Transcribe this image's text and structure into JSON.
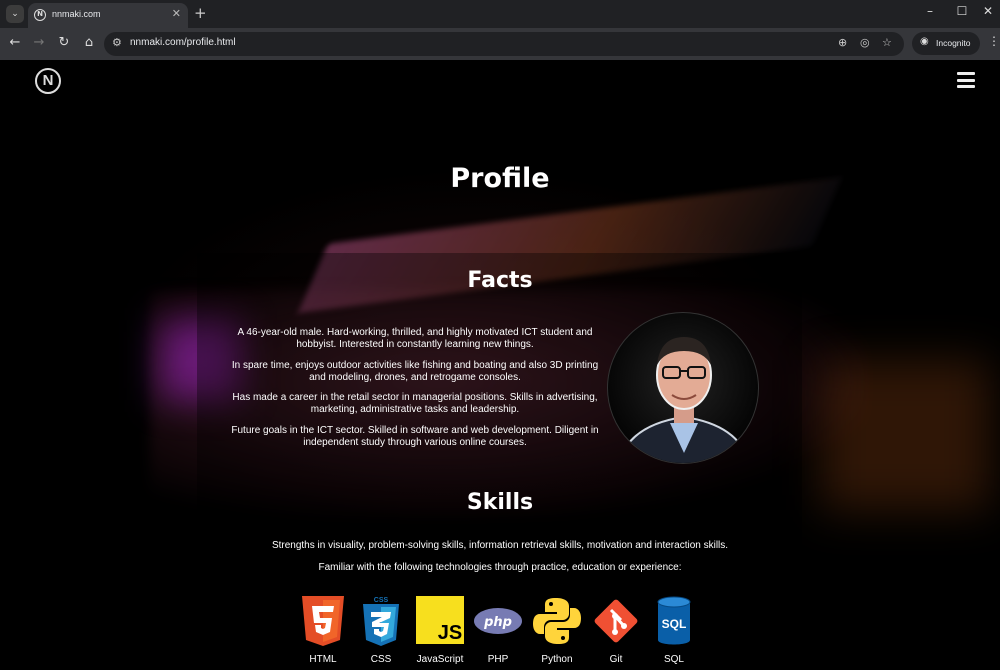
{
  "browser": {
    "tab_title": "nnmaki.com",
    "url": "nnmaki.com/profile.html",
    "incognito_label": "Incognito",
    "icons": {
      "tab_list": "chevron-down-icon",
      "new_tab": "plus-icon",
      "back": "arrow-left-icon",
      "forward": "arrow-right-icon",
      "reload": "reload-icon",
      "home": "home-icon",
      "zoom": "zoom-icon",
      "tracking": "eye-slash-icon",
      "bookmark": "star-icon"
    }
  },
  "site": {
    "logo_text": "N",
    "title": "Profile",
    "facts": {
      "heading": "Facts",
      "paragraphs": [
        "A 46-year-old male. Hard-working, thrilled, and highly motivated ICT student and hobbyist. Interested in constantly learning new things.",
        "In spare time, enjoys outdoor activities like fishing and boating and also 3D printing and modeling, drones, and retrogame consoles.",
        "Has made a career in the retail sector in managerial positions. Skills in advertising, marketing, administrative tasks and leadership.",
        "Future goals in the ICT sector. Skilled in software and web development. Diligent in independent study through various online courses."
      ]
    },
    "skills": {
      "heading": "Skills",
      "strengths": "Strengths in visuality, problem-solving skills, information retrieval skills, motivation and interaction skills.",
      "familiar": "Familiar with the following technologies through practice, education or experience:",
      "technologies": [
        {
          "label": "HTML",
          "icon": "html5-icon"
        },
        {
          "label": "CSS",
          "icon": "css3-icon"
        },
        {
          "label": "JavaScript",
          "icon": "javascript-icon"
        },
        {
          "label": "PHP",
          "icon": "php-icon"
        },
        {
          "label": "Python",
          "icon": "python-icon"
        },
        {
          "label": "Git",
          "icon": "git-icon"
        },
        {
          "label": "SQL",
          "icon": "sql-icon"
        }
      ]
    }
  },
  "colors": {
    "html": "#e44d26",
    "css": "#1572b6",
    "javascript": "#f7df1e",
    "php": "#777bb3",
    "python_blue": "#3776ab",
    "python_yellow": "#ffd43b",
    "git": "#f05033",
    "sql": "#0a5fa8"
  }
}
